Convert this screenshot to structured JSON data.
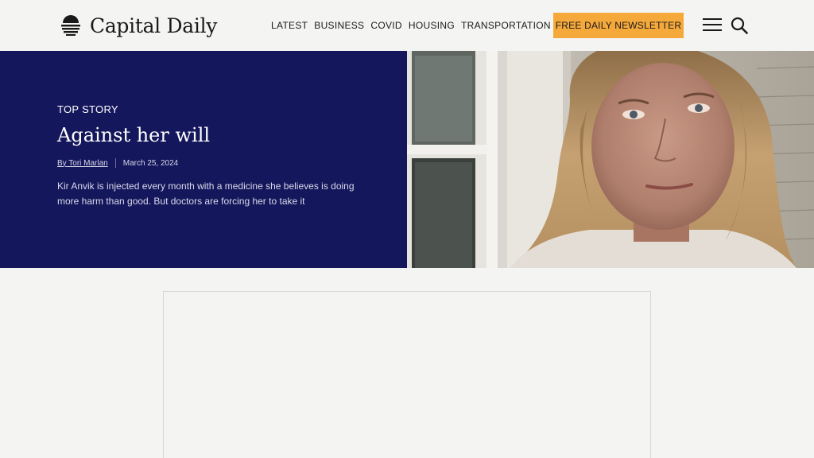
{
  "header": {
    "logo_text": "Capital Daily",
    "nav": [
      "LATEST",
      "BUSINESS",
      "COVID",
      "HOUSING",
      "TRANSPORTATION"
    ],
    "newsletter_label": "FREE DAILY NEWSLETTER",
    "icons": {
      "menu": "hamburger-menu-icon",
      "search": "search-icon",
      "logo": "sunrise-logo-icon"
    }
  },
  "hero": {
    "kicker": "TOP STORY",
    "headline": "Against her will",
    "author": "By Tori Marlan",
    "date": "March 25, 2024",
    "dek": "Kir Anvik is injected every month with a medicine she believes is doing more harm than good. But doctors are forcing her to take it"
  },
  "colors": {
    "background": "#f4f4f2",
    "hero_panel": "#15175c",
    "newsletter_button": "#f5a93b",
    "text": "#1a1a1a"
  }
}
